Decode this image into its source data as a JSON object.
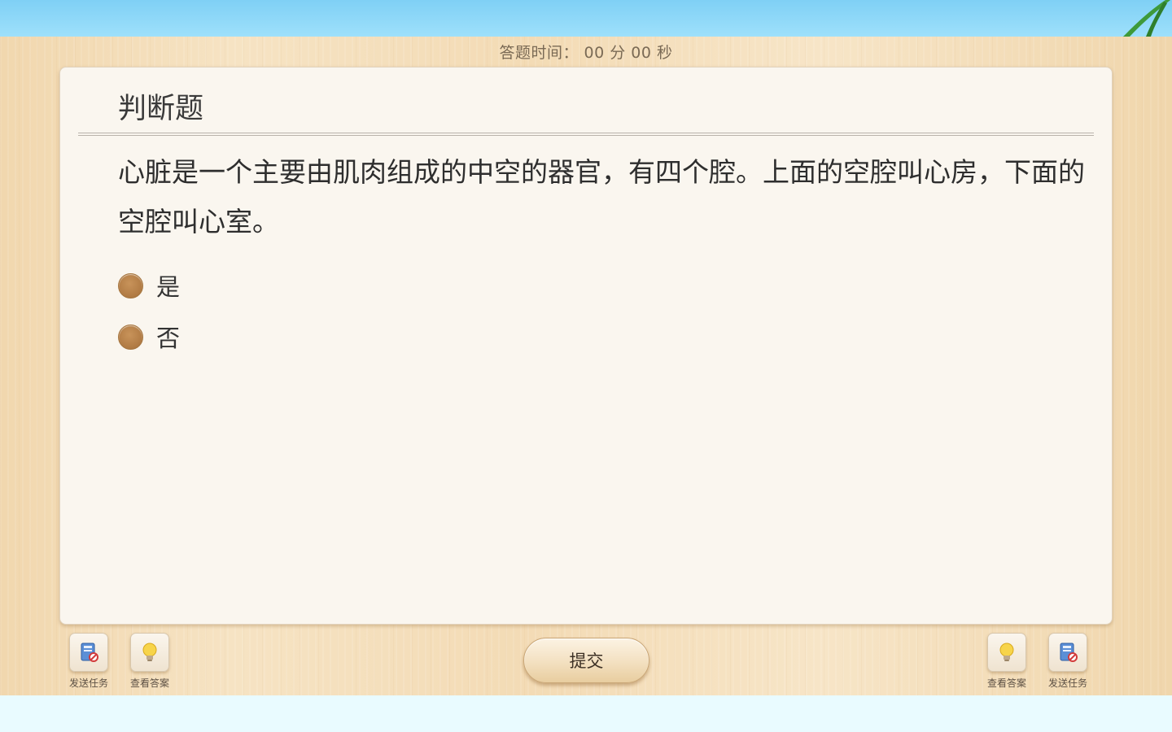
{
  "timer": {
    "label": "答题时间：",
    "minutes": "00",
    "minutes_unit": "分",
    "seconds": "00",
    "seconds_unit": "秒"
  },
  "question": {
    "type": "判断题",
    "text": "心脏是一个主要由肌肉组成的中空的器官，有四个腔。上面的空腔叫心房，下面的空腔叫心室。",
    "options": [
      {
        "label": "是"
      },
      {
        "label": "否"
      }
    ]
  },
  "toolbar": {
    "left": [
      {
        "label": "发送任务",
        "icon": "send-task-icon"
      },
      {
        "label": "查看答案",
        "icon": "lightbulb-icon"
      }
    ],
    "right": [
      {
        "label": "查看答案",
        "icon": "lightbulb-icon"
      },
      {
        "label": "发送任务",
        "icon": "send-task-icon"
      }
    ],
    "submit_label": "提交"
  },
  "colors": {
    "radio": "#b07a43",
    "card": "#faf6ef",
    "sky": "#7fd0f5"
  }
}
